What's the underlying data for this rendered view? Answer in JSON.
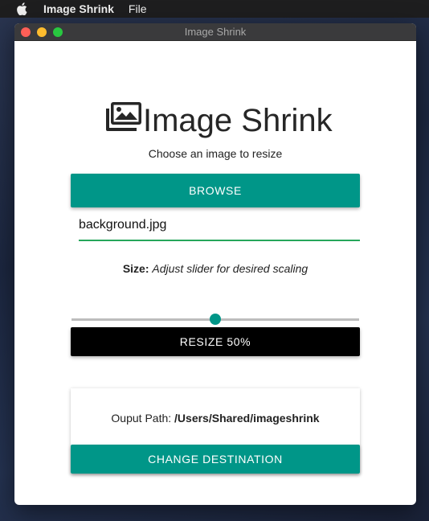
{
  "menubar": {
    "app_name": "Image Shrink",
    "menu_file": "File"
  },
  "window": {
    "title": "Image Shrink"
  },
  "main": {
    "logo_text": "Image Shrink",
    "subtitle": "Choose an image to resize",
    "browse_label": "BROWSE",
    "file_value": "background.jpg",
    "size_label": "Size:",
    "size_hint": "Adjust slider for desired scaling",
    "slider_value": 50,
    "resize_label": "RESIZE 50%",
    "output_label": "Ouput Path:",
    "output_path": "/Users/Shared/imageshrink",
    "change_label": "CHANGE DESTINATION"
  },
  "colors": {
    "accent": "#009688",
    "resize_bg": "#000000",
    "field_underline": "#26a65b"
  },
  "icons": [
    "apple-icon",
    "images-icon"
  ]
}
